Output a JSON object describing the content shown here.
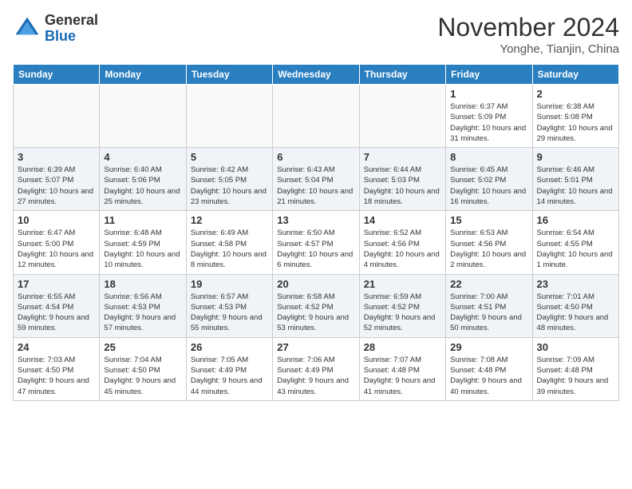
{
  "header": {
    "logo_general": "General",
    "logo_blue": "Blue",
    "month_title": "November 2024",
    "location": "Yonghe, Tianjin, China"
  },
  "weekdays": [
    "Sunday",
    "Monday",
    "Tuesday",
    "Wednesday",
    "Thursday",
    "Friday",
    "Saturday"
  ],
  "weeks": [
    [
      {
        "day": "",
        "info": ""
      },
      {
        "day": "",
        "info": ""
      },
      {
        "day": "",
        "info": ""
      },
      {
        "day": "",
        "info": ""
      },
      {
        "day": "",
        "info": ""
      },
      {
        "day": "1",
        "info": "Sunrise: 6:37 AM\nSunset: 5:09 PM\nDaylight: 10 hours and 31 minutes."
      },
      {
        "day": "2",
        "info": "Sunrise: 6:38 AM\nSunset: 5:08 PM\nDaylight: 10 hours and 29 minutes."
      }
    ],
    [
      {
        "day": "3",
        "info": "Sunrise: 6:39 AM\nSunset: 5:07 PM\nDaylight: 10 hours and 27 minutes."
      },
      {
        "day": "4",
        "info": "Sunrise: 6:40 AM\nSunset: 5:06 PM\nDaylight: 10 hours and 25 minutes."
      },
      {
        "day": "5",
        "info": "Sunrise: 6:42 AM\nSunset: 5:05 PM\nDaylight: 10 hours and 23 minutes."
      },
      {
        "day": "6",
        "info": "Sunrise: 6:43 AM\nSunset: 5:04 PM\nDaylight: 10 hours and 21 minutes."
      },
      {
        "day": "7",
        "info": "Sunrise: 6:44 AM\nSunset: 5:03 PM\nDaylight: 10 hours and 18 minutes."
      },
      {
        "day": "8",
        "info": "Sunrise: 6:45 AM\nSunset: 5:02 PM\nDaylight: 10 hours and 16 minutes."
      },
      {
        "day": "9",
        "info": "Sunrise: 6:46 AM\nSunset: 5:01 PM\nDaylight: 10 hours and 14 minutes."
      }
    ],
    [
      {
        "day": "10",
        "info": "Sunrise: 6:47 AM\nSunset: 5:00 PM\nDaylight: 10 hours and 12 minutes."
      },
      {
        "day": "11",
        "info": "Sunrise: 6:48 AM\nSunset: 4:59 PM\nDaylight: 10 hours and 10 minutes."
      },
      {
        "day": "12",
        "info": "Sunrise: 6:49 AM\nSunset: 4:58 PM\nDaylight: 10 hours and 8 minutes."
      },
      {
        "day": "13",
        "info": "Sunrise: 6:50 AM\nSunset: 4:57 PM\nDaylight: 10 hours and 6 minutes."
      },
      {
        "day": "14",
        "info": "Sunrise: 6:52 AM\nSunset: 4:56 PM\nDaylight: 10 hours and 4 minutes."
      },
      {
        "day": "15",
        "info": "Sunrise: 6:53 AM\nSunset: 4:56 PM\nDaylight: 10 hours and 2 minutes."
      },
      {
        "day": "16",
        "info": "Sunrise: 6:54 AM\nSunset: 4:55 PM\nDaylight: 10 hours and 1 minute."
      }
    ],
    [
      {
        "day": "17",
        "info": "Sunrise: 6:55 AM\nSunset: 4:54 PM\nDaylight: 9 hours and 59 minutes."
      },
      {
        "day": "18",
        "info": "Sunrise: 6:56 AM\nSunset: 4:53 PM\nDaylight: 9 hours and 57 minutes."
      },
      {
        "day": "19",
        "info": "Sunrise: 6:57 AM\nSunset: 4:53 PM\nDaylight: 9 hours and 55 minutes."
      },
      {
        "day": "20",
        "info": "Sunrise: 6:58 AM\nSunset: 4:52 PM\nDaylight: 9 hours and 53 minutes."
      },
      {
        "day": "21",
        "info": "Sunrise: 6:59 AM\nSunset: 4:52 PM\nDaylight: 9 hours and 52 minutes."
      },
      {
        "day": "22",
        "info": "Sunrise: 7:00 AM\nSunset: 4:51 PM\nDaylight: 9 hours and 50 minutes."
      },
      {
        "day": "23",
        "info": "Sunrise: 7:01 AM\nSunset: 4:50 PM\nDaylight: 9 hours and 48 minutes."
      }
    ],
    [
      {
        "day": "24",
        "info": "Sunrise: 7:03 AM\nSunset: 4:50 PM\nDaylight: 9 hours and 47 minutes."
      },
      {
        "day": "25",
        "info": "Sunrise: 7:04 AM\nSunset: 4:50 PM\nDaylight: 9 hours and 45 minutes."
      },
      {
        "day": "26",
        "info": "Sunrise: 7:05 AM\nSunset: 4:49 PM\nDaylight: 9 hours and 44 minutes."
      },
      {
        "day": "27",
        "info": "Sunrise: 7:06 AM\nSunset: 4:49 PM\nDaylight: 9 hours and 43 minutes."
      },
      {
        "day": "28",
        "info": "Sunrise: 7:07 AM\nSunset: 4:48 PM\nDaylight: 9 hours and 41 minutes."
      },
      {
        "day": "29",
        "info": "Sunrise: 7:08 AM\nSunset: 4:48 PM\nDaylight: 9 hours and 40 minutes."
      },
      {
        "day": "30",
        "info": "Sunrise: 7:09 AM\nSunset: 4:48 PM\nDaylight: 9 hours and 39 minutes."
      }
    ]
  ]
}
